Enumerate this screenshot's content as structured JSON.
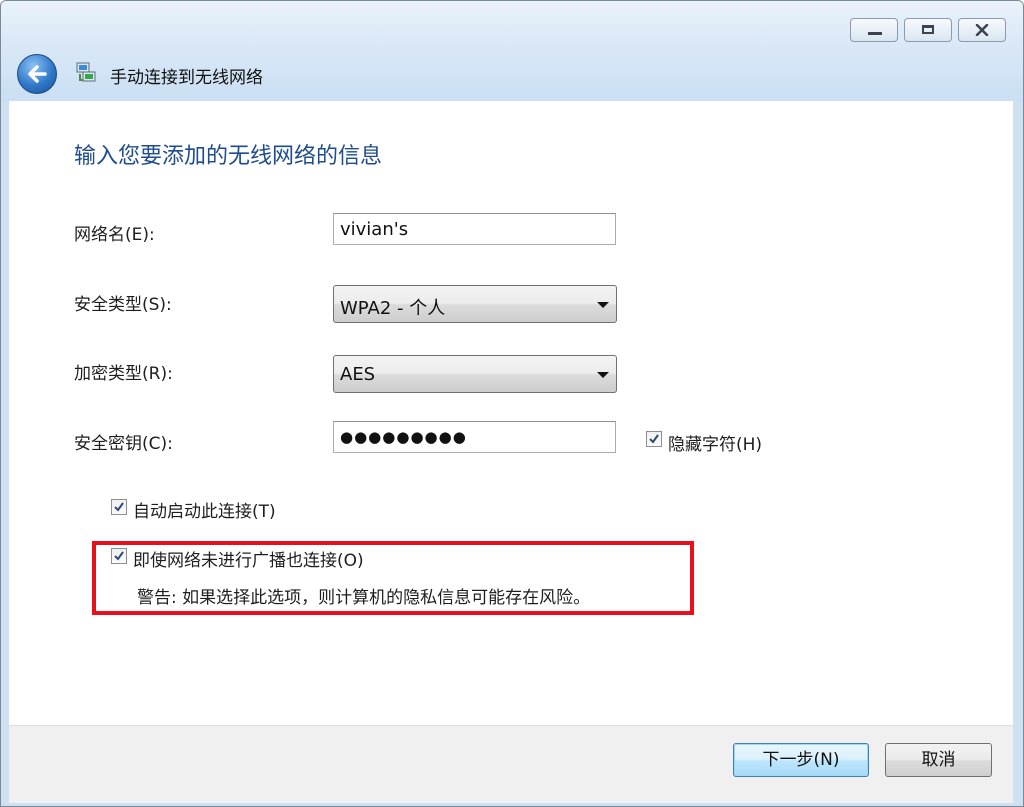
{
  "window": {
    "title": "手动连接到无线网络",
    "controls": {
      "minimize_icon": "minimize-icon",
      "maximize_icon": "maximize-icon",
      "close_icon": "close-icon"
    }
  },
  "page": {
    "heading": "输入您要添加的无线网络的信息"
  },
  "form": {
    "network_name": {
      "label": "网络名(E):",
      "value": "vivian's"
    },
    "security_type": {
      "label": "安全类型(S):",
      "value": "WPA2 - 个人"
    },
    "encryption_type": {
      "label": "加密类型(R):",
      "value": "AES"
    },
    "security_key": {
      "label": "安全密钥(C):",
      "value": "●●●●●●●●●"
    },
    "hide_characters": {
      "label": "隐藏字符(H)",
      "checked": true
    }
  },
  "options": {
    "auto_connect": {
      "label": "自动启动此连接(T)",
      "checked": true
    },
    "connect_even_if_not_broadcasting": {
      "label": "即使网络未进行广播也连接(O)",
      "checked": true
    },
    "warning": "警告: 如果选择此选项，则计算机的隐私信息可能存在风险。"
  },
  "buttons": {
    "next": "下一步(N)",
    "cancel": "取消"
  },
  "colors": {
    "heading": "#1f4c8f",
    "highlight_border": "#e8101d",
    "titlebar": "#d9e8f7",
    "footer": "#f0f0f0"
  }
}
